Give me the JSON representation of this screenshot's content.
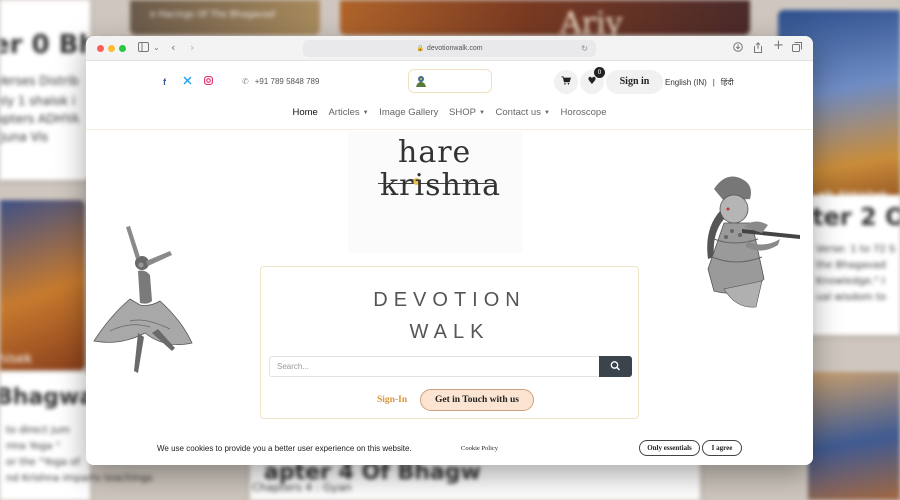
{
  "background": {
    "fragments": [
      "er 0 Bhag",
      "Verses Distrib",
      "nly 1 shalok i",
      "apters ADHYA",
      "rjuna Vis",
      "Ariy",
      "ter 2 Of",
      "Verse: 1 to 72 S",
      "the Bhagavad",
      "Knowledge.\" I",
      "ual wisdom to",
      "hisek",
      "Bhagwa",
      "to direct jum",
      "rma Yoga \"",
      "or the \"Yoga of",
      "nd Krishna imparts teachings",
      "apter 4 Of Bhagw",
      "Chapters 4 : Gyan",
      "alk Abhishek",
      "Walk Abhishek",
      "e Hacings Of The Bhagavad"
    ]
  },
  "browser": {
    "url": "devotionwalk.com"
  },
  "topbar": {
    "social_icons": [
      "facebook-icon",
      "twitter-icon",
      "instagram-icon"
    ],
    "phone": "+91 789 5848 789",
    "wishlist_count": "0",
    "signin_label": "Sign in",
    "language": "English (IN)",
    "language_separator": "|",
    "alt_language": "हिंदी"
  },
  "nav": {
    "items": [
      {
        "label": "Home",
        "active": true
      },
      {
        "label": "Articles",
        "dropdown": true
      },
      {
        "label": "Image Gallery"
      },
      {
        "label": "SHOP",
        "dropdown": true
      },
      {
        "label": "Contact us",
        "dropdown": true
      },
      {
        "label": "Horoscope"
      }
    ]
  },
  "hero": {
    "logo_line1": "hare",
    "logo_line2": "krishna",
    "title_line1": "DEVOTION",
    "title_line2": "WALK",
    "search_placeholder": "Search...",
    "signin_link": "Sign-In",
    "contact_button": "Get in Touch with us"
  },
  "cookie": {
    "text": "We use cookies to provide you a better user experience on this website.",
    "policy_link": "Cookie Policy",
    "essentials_button": "Only essentials",
    "agree_button": "I agree"
  },
  "colors": {
    "accent": "#d9953c",
    "search_button": "#3b434d",
    "contact_button_bg": "#fbe5d2",
    "facebook": "#3b5998",
    "twitter": "#1da1f2",
    "instagram": "#e1306c"
  }
}
